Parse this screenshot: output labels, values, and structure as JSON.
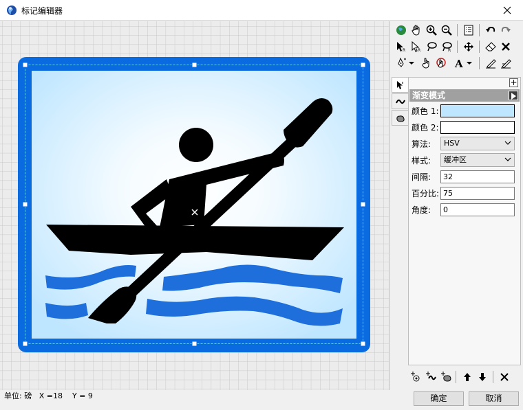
{
  "window": {
    "title": "标记编辑器"
  },
  "panel": {
    "plus_label": "+",
    "mode_title": "渐变模式",
    "color1_label": "颜色 1:",
    "color1_value": "#bfe6ff",
    "color2_label": "颜色 2:",
    "color2_value": "#ffffff",
    "algorithm_label": "算法:",
    "algorithm_value": "HSV",
    "style_label": "样式:",
    "style_value": "缓冲区",
    "interval_label": "间隔:",
    "interval_value": "32",
    "percent_label": "百分比:",
    "percent_value": "75",
    "angle_label": "角度:",
    "angle_value": "0"
  },
  "status": {
    "unit_text": "单位: 磅",
    "x_text": "X =18",
    "y_text": "Y = 9"
  },
  "buttons": {
    "ok": "确定",
    "cancel": "取消"
  },
  "symbol": {
    "frame_color": "#0a6ae0",
    "water_color": "#1e6fdc",
    "figure_color": "#000000"
  }
}
